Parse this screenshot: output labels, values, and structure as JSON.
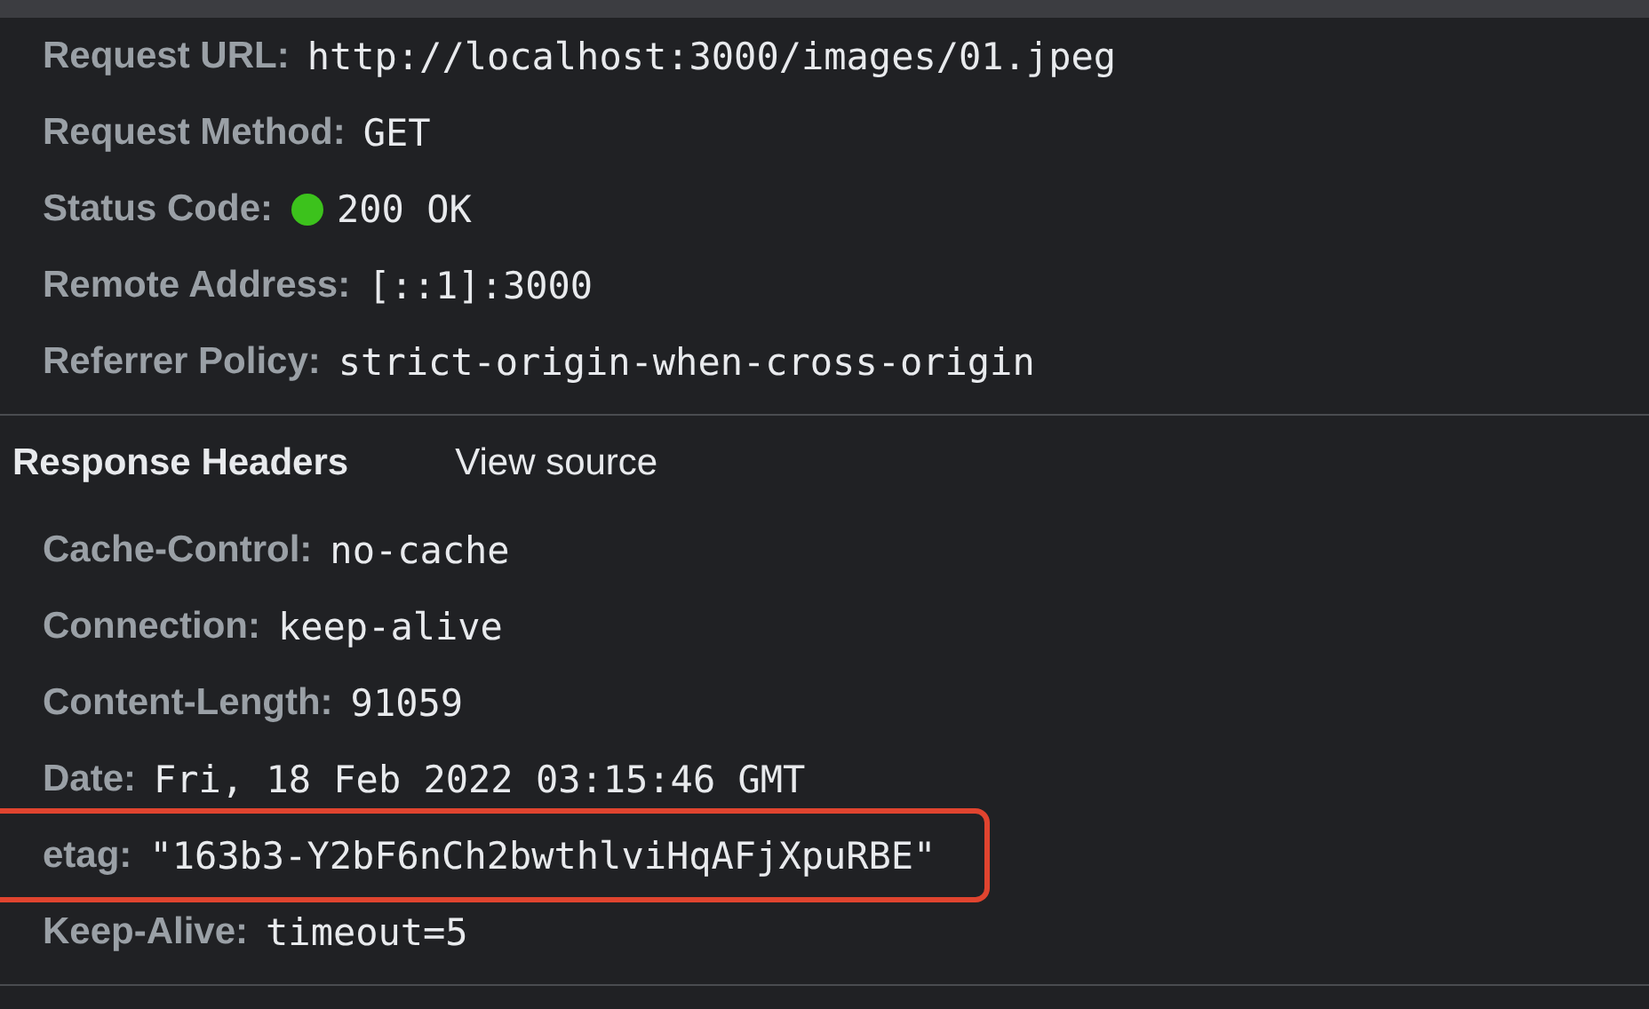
{
  "general": [
    {
      "label": "Request URL:",
      "value": "http://localhost:3000/images/01.jpeg"
    },
    {
      "label": "Request Method:",
      "value": "GET"
    },
    {
      "label": "Status Code:",
      "value": "200 OK",
      "color": "#3cc21c"
    },
    {
      "label": "Remote Address:",
      "value": "[::1]:3000"
    },
    {
      "label": "Referrer Policy:",
      "value": "strict-origin-when-cross-origin"
    }
  ],
  "response_headers": {
    "title": "Response Headers",
    "view_source": "View source",
    "items": [
      {
        "label": "Cache-Control:",
        "value": "no-cache",
        "highlighted": false
      },
      {
        "label": "Connection:",
        "value": "keep-alive",
        "highlighted": false
      },
      {
        "label": "Content-Length:",
        "value": "91059",
        "highlighted": false
      },
      {
        "label": "Date:",
        "value": "Fri, 18 Feb 2022 03:15:46 GMT",
        "highlighted": false
      },
      {
        "label": "etag:",
        "value": "\"163b3-Y2bF6nCh2bwthlviHqAFjXpuRBE\"",
        "highlighted": true
      },
      {
        "label": "Keep-Alive:",
        "value": "timeout=5",
        "highlighted": false
      }
    ]
  }
}
